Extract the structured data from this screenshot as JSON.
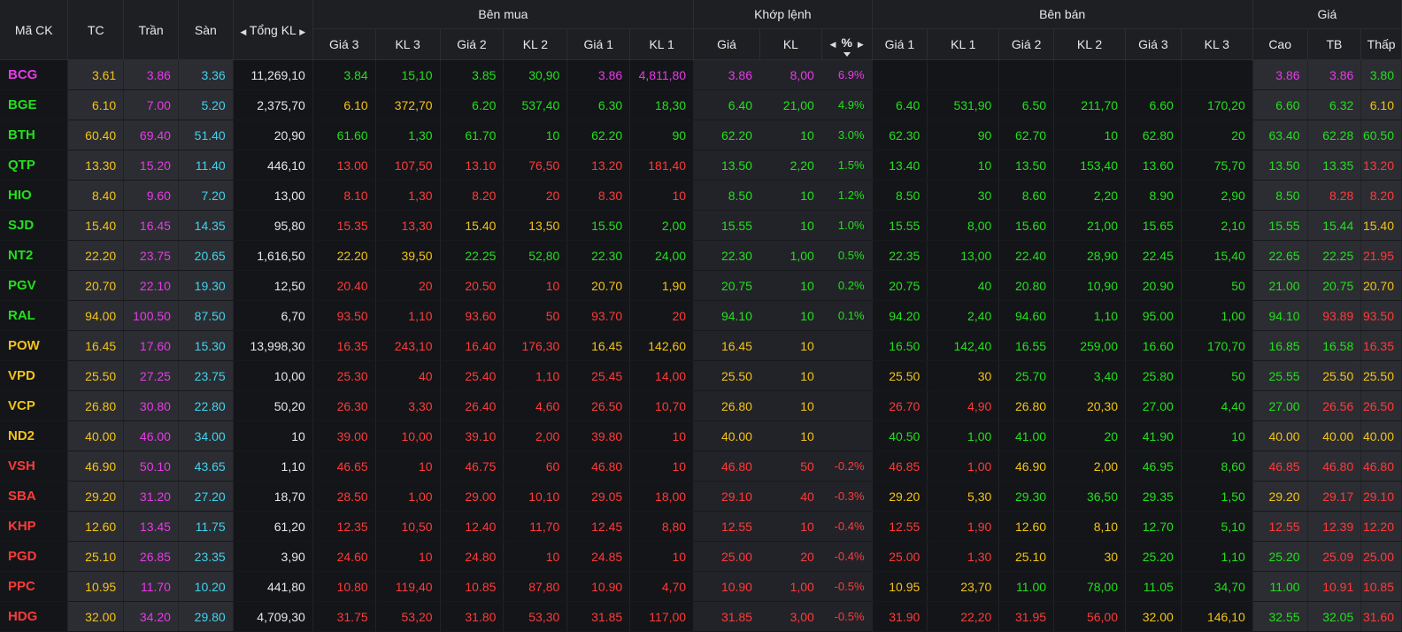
{
  "header": {
    "code": "Mã CK",
    "tc": "TC",
    "tran": "Trần",
    "san": "Sàn",
    "tong_kl": "Tổng KL",
    "ben_mua": "Bên mua",
    "khop_lenh": "Khớp lệnh",
    "ben_ban": "Bên bán",
    "gia": "Giá",
    "sub": {
      "gia3": "Giá 3",
      "kl3": "KL 3",
      "gia2": "Giá 2",
      "kl2": "KL 2",
      "gia1": "Giá 1",
      "kl1": "KL 1",
      "gia": "Giá",
      "kl": "KL",
      "pct": "%",
      "cao": "Cao",
      "tb": "TB",
      "thap": "Thấp"
    }
  },
  "icons": {
    "left": "caret-left-icon",
    "right": "caret-right-icon",
    "sort_down": "caret-down-icon"
  },
  "colors": {
    "up": "#22e01d",
    "down": "#ff3a3a",
    "ref": "#f2c318",
    "ceil": "#e83ae8",
    "floor": "#3fd3ee"
  },
  "rows": [
    {
      "code": "BCG",
      "tc": "3.61",
      "tran": "3.86",
      "san": "3.36",
      "tong": "11,269,10",
      "b3": "3.84",
      "bk3": "15,10",
      "b2": "3.85",
      "bk2": "30,90",
      "b1": "3.86",
      "bk1": "4,811,80",
      "mp": "3.86",
      "mk": "8,00",
      "pct": "6.9%",
      "s1": "",
      "sk1": "",
      "s2": "",
      "sk2": "",
      "s3": "",
      "sk3": "",
      "cao": "3.86",
      "tb": "3.86",
      "thap": "3.80"
    },
    {
      "code": "BGE",
      "tc": "6.10",
      "tran": "7.00",
      "san": "5.20",
      "tong": "2,375,70",
      "b3": "6.10",
      "bk3": "372,70",
      "b2": "6.20",
      "bk2": "537,40",
      "b1": "6.30",
      "bk1": "18,30",
      "mp": "6.40",
      "mk": "21,00",
      "pct": "4.9%",
      "s1": "6.40",
      "sk1": "531,90",
      "s2": "6.50",
      "sk2": "211,70",
      "s3": "6.60",
      "sk3": "170,20",
      "cao": "6.60",
      "tb": "6.32",
      "thap": "6.10"
    },
    {
      "code": "BTH",
      "tc": "60.40",
      "tran": "69.40",
      "san": "51.40",
      "tong": "20,90",
      "b3": "61.60",
      "bk3": "1,30",
      "b2": "61.70",
      "bk2": "10",
      "b1": "62.20",
      "bk1": "90",
      "mp": "62.20",
      "mk": "10",
      "pct": "3.0%",
      "s1": "62.30",
      "sk1": "90",
      "s2": "62.70",
      "sk2": "10",
      "s3": "62.80",
      "sk3": "20",
      "cao": "63.40",
      "tb": "62.28",
      "thap": "60.50"
    },
    {
      "code": "QTP",
      "tc": "13.30",
      "tran": "15.20",
      "san": "11.40",
      "tong": "446,10",
      "b3": "13.00",
      "bk3": "107,50",
      "b2": "13.10",
      "bk2": "76,50",
      "b1": "13.20",
      "bk1": "181,40",
      "mp": "13.50",
      "mk": "2,20",
      "pct": "1.5%",
      "s1": "13.40",
      "sk1": "10",
      "s2": "13.50",
      "sk2": "153,40",
      "s3": "13.60",
      "sk3": "75,70",
      "cao": "13.50",
      "tb": "13.35",
      "thap": "13.20"
    },
    {
      "code": "HIO",
      "tc": "8.40",
      "tran": "9.60",
      "san": "7.20",
      "tong": "13,00",
      "b3": "8.10",
      "bk3": "1,30",
      "b2": "8.20",
      "bk2": "20",
      "b1": "8.30",
      "bk1": "10",
      "mp": "8.50",
      "mk": "10",
      "pct": "1.2%",
      "s1": "8.50",
      "sk1": "30",
      "s2": "8.60",
      "sk2": "2,20",
      "s3": "8.90",
      "sk3": "2,90",
      "cao": "8.50",
      "tb": "8.28",
      "thap": "8.20"
    },
    {
      "code": "SJD",
      "tc": "15.40",
      "tran": "16.45",
      "san": "14.35",
      "tong": "95,80",
      "b3": "15.35",
      "bk3": "13,30",
      "b2": "15.40",
      "bk2": "13,50",
      "b1": "15.50",
      "bk1": "2,00",
      "mp": "15.55",
      "mk": "10",
      "pct": "1.0%",
      "s1": "15.55",
      "sk1": "8,00",
      "s2": "15.60",
      "sk2": "21,00",
      "s3": "15.65",
      "sk3": "2,10",
      "cao": "15.55",
      "tb": "15.44",
      "thap": "15.40"
    },
    {
      "code": "NT2",
      "tc": "22.20",
      "tran": "23.75",
      "san": "20.65",
      "tong": "1,616,50",
      "b3": "22.20",
      "bk3": "39,50",
      "b2": "22.25",
      "bk2": "52,80",
      "b1": "22.30",
      "bk1": "24,00",
      "mp": "22.30",
      "mk": "1,00",
      "pct": "0.5%",
      "s1": "22.35",
      "sk1": "13,00",
      "s2": "22.40",
      "sk2": "28,90",
      "s3": "22.45",
      "sk3": "15,40",
      "cao": "22.65",
      "tb": "22.25",
      "thap": "21.95"
    },
    {
      "code": "PGV",
      "tc": "20.70",
      "tran": "22.10",
      "san": "19.30",
      "tong": "12,50",
      "b3": "20.40",
      "bk3": "20",
      "b2": "20.50",
      "bk2": "10",
      "b1": "20.70",
      "bk1": "1,90",
      "mp": "20.75",
      "mk": "10",
      "pct": "0.2%",
      "s1": "20.75",
      "sk1": "40",
      "s2": "20.80",
      "sk2": "10,90",
      "s3": "20.90",
      "sk3": "50",
      "cao": "21.00",
      "tb": "20.75",
      "thap": "20.70"
    },
    {
      "code": "RAL",
      "tc": "94.00",
      "tran": "100.50",
      "san": "87.50",
      "tong": "6,70",
      "b3": "93.50",
      "bk3": "1,10",
      "b2": "93.60",
      "bk2": "50",
      "b1": "93.70",
      "bk1": "20",
      "mp": "94.10",
      "mk": "10",
      "pct": "0.1%",
      "s1": "94.20",
      "sk1": "2,40",
      "s2": "94.60",
      "sk2": "1,10",
      "s3": "95.00",
      "sk3": "1,00",
      "cao": "94.10",
      "tb": "93.89",
      "thap": "93.50"
    },
    {
      "code": "POW",
      "tc": "16.45",
      "tran": "17.60",
      "san": "15.30",
      "tong": "13,998,30",
      "b3": "16.35",
      "bk3": "243,10",
      "b2": "16.40",
      "bk2": "176,30",
      "b1": "16.45",
      "bk1": "142,60",
      "mp": "16.45",
      "mk": "10",
      "pct": "",
      "s1": "16.50",
      "sk1": "142,40",
      "s2": "16.55",
      "sk2": "259,00",
      "s3": "16.60",
      "sk3": "170,70",
      "cao": "16.85",
      "tb": "16.58",
      "thap": "16.35"
    },
    {
      "code": "VPD",
      "tc": "25.50",
      "tran": "27.25",
      "san": "23.75",
      "tong": "10,00",
      "b3": "25.30",
      "bk3": "40",
      "b2": "25.40",
      "bk2": "1,10",
      "b1": "25.45",
      "bk1": "14,00",
      "mp": "25.50",
      "mk": "10",
      "pct": "",
      "s1": "25.50",
      "sk1": "30",
      "s2": "25.70",
      "sk2": "3,40",
      "s3": "25.80",
      "sk3": "50",
      "cao": "25.55",
      "tb": "25.50",
      "thap": "25.50"
    },
    {
      "code": "VCP",
      "tc": "26.80",
      "tran": "30.80",
      "san": "22.80",
      "tong": "50,20",
      "b3": "26.30",
      "bk3": "3,30",
      "b2": "26.40",
      "bk2": "4,60",
      "b1": "26.50",
      "bk1": "10,70",
      "mp": "26.80",
      "mk": "10",
      "pct": "",
      "s1": "26.70",
      "sk1": "4,90",
      "s2": "26.80",
      "sk2": "20,30",
      "s3": "27.00",
      "sk3": "4,40",
      "cao": "27.00",
      "tb": "26.56",
      "thap": "26.50"
    },
    {
      "code": "ND2",
      "tc": "40.00",
      "tran": "46.00",
      "san": "34.00",
      "tong": "10",
      "b3": "39.00",
      "bk3": "10,00",
      "b2": "39.10",
      "bk2": "2,00",
      "b1": "39.80",
      "bk1": "10",
      "mp": "40.00",
      "mk": "10",
      "pct": "",
      "s1": "40.50",
      "sk1": "1,00",
      "s2": "41.00",
      "sk2": "20",
      "s3": "41.90",
      "sk3": "10",
      "cao": "40.00",
      "tb": "40.00",
      "thap": "40.00"
    },
    {
      "code": "VSH",
      "tc": "46.90",
      "tran": "50.10",
      "san": "43.65",
      "tong": "1,10",
      "b3": "46.65",
      "bk3": "10",
      "b2": "46.75",
      "bk2": "60",
      "b1": "46.80",
      "bk1": "10",
      "mp": "46.80",
      "mk": "50",
      "pct": "-0.2%",
      "s1": "46.85",
      "sk1": "1,00",
      "s2": "46.90",
      "sk2": "2,00",
      "s3": "46.95",
      "sk3": "8,60",
      "cao": "46.85",
      "tb": "46.80",
      "thap": "46.80"
    },
    {
      "code": "SBA",
      "tc": "29.20",
      "tran": "31.20",
      "san": "27.20",
      "tong": "18,70",
      "b3": "28.50",
      "bk3": "1,00",
      "b2": "29.00",
      "bk2": "10,10",
      "b1": "29.05",
      "bk1": "18,00",
      "mp": "29.10",
      "mk": "40",
      "pct": "-0.3%",
      "s1": "29.20",
      "sk1": "5,30",
      "s2": "29.30",
      "sk2": "36,50",
      "s3": "29.35",
      "sk3": "1,50",
      "cao": "29.20",
      "tb": "29.17",
      "thap": "29.10"
    },
    {
      "code": "KHP",
      "tc": "12.60",
      "tran": "13.45",
      "san": "11.75",
      "tong": "61,20",
      "b3": "12.35",
      "bk3": "10,50",
      "b2": "12.40",
      "bk2": "11,70",
      "b1": "12.45",
      "bk1": "8,80",
      "mp": "12.55",
      "mk": "10",
      "pct": "-0.4%",
      "s1": "12.55",
      "sk1": "1,90",
      "s2": "12.60",
      "sk2": "8,10",
      "s3": "12.70",
      "sk3": "5,10",
      "cao": "12.55",
      "tb": "12.39",
      "thap": "12.20"
    },
    {
      "code": "PGD",
      "tc": "25.10",
      "tran": "26.85",
      "san": "23.35",
      "tong": "3,90",
      "b3": "24.60",
      "bk3": "10",
      "b2": "24.80",
      "bk2": "10",
      "b1": "24.85",
      "bk1": "10",
      "mp": "25.00",
      "mk": "20",
      "pct": "-0.4%",
      "s1": "25.00",
      "sk1": "1,30",
      "s2": "25.10",
      "sk2": "30",
      "s3": "25.20",
      "sk3": "1,10",
      "cao": "25.20",
      "tb": "25.09",
      "thap": "25.00"
    },
    {
      "code": "PPC",
      "tc": "10.95",
      "tran": "11.70",
      "san": "10.20",
      "tong": "441,80",
      "b3": "10.80",
      "bk3": "119,40",
      "b2": "10.85",
      "bk2": "87,80",
      "b1": "10.90",
      "bk1": "4,70",
      "mp": "10.90",
      "mk": "1,00",
      "pct": "-0.5%",
      "s1": "10.95",
      "sk1": "23,70",
      "s2": "11.00",
      "sk2": "78,00",
      "s3": "11.05",
      "sk3": "34,70",
      "cao": "11.00",
      "tb": "10.91",
      "thap": "10.85"
    },
    {
      "code": "HDG",
      "tc": "32.00",
      "tran": "34.20",
      "san": "29.80",
      "tong": "4,709,30",
      "b3": "31.75",
      "bk3": "53,20",
      "b2": "31.80",
      "bk2": "53,30",
      "b1": "31.85",
      "bk1": "117,00",
      "mp": "31.85",
      "mk": "3,00",
      "pct": "-0.5%",
      "s1": "31.90",
      "sk1": "22,20",
      "s2": "31.95",
      "sk2": "56,00",
      "s3": "32.00",
      "sk3": "146,10",
      "cao": "32.55",
      "tb": "32.05",
      "thap": "31.60"
    }
  ]
}
